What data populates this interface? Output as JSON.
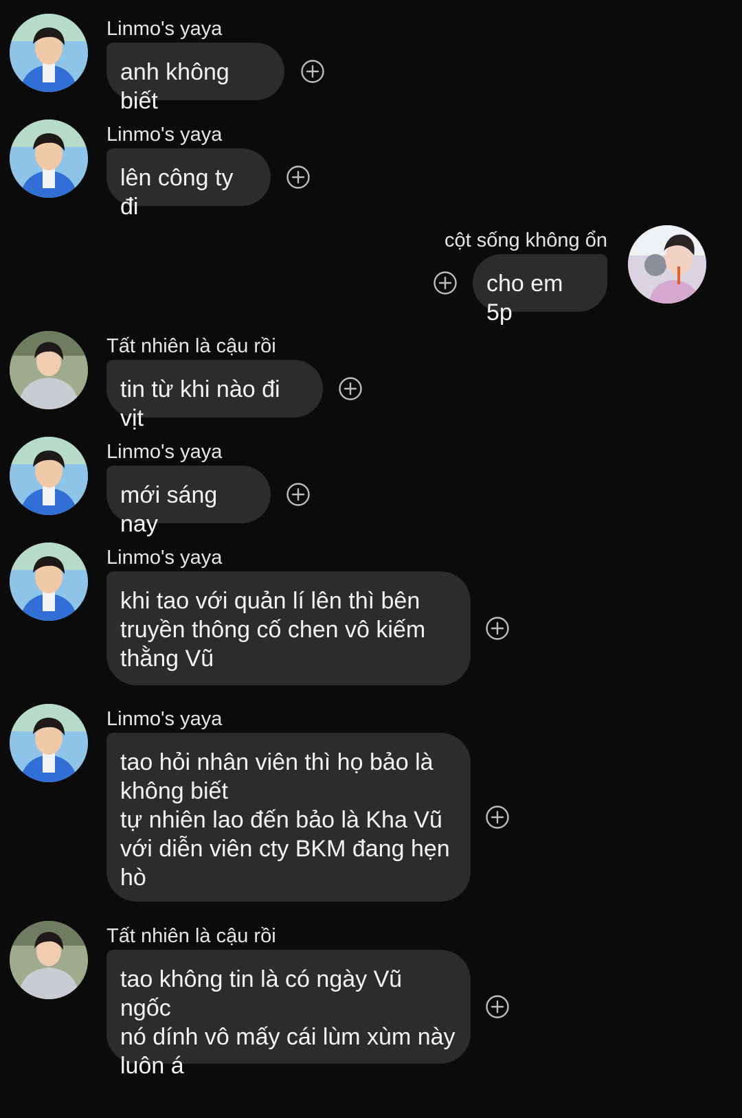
{
  "icons": {
    "react": "add-reaction-icon",
    "avatar": "user-avatar"
  },
  "colors": {
    "background": "#0b0b0b",
    "bubble": "#2c2c2c",
    "text": "#f4f4f4",
    "icon": "#bdbdbd"
  },
  "messages": [
    {
      "sender": "Linmo's yaya",
      "text": "anh không biết"
    },
    {
      "sender": "Linmo's yaya",
      "text": "lên công ty đi"
    },
    {
      "sender": "cột sống không ổn",
      "text": "cho em 5p"
    },
    {
      "sender": "Tất nhiên là cậu rồi",
      "text": "tin từ khi nào đi vịt"
    },
    {
      "sender": "Linmo's yaya",
      "text": "mới sáng nay"
    },
    {
      "sender": "Linmo's yaya",
      "text": "khi tao với quản lí lên thì bên\ntruyền thông cố chen vô kiếm\nthằng Vũ"
    },
    {
      "sender": "Linmo's yaya",
      "text": "tao hỏi nhân viên thì họ bảo là\nkhông biết\ntự nhiên lao đến bảo là Kha Vũ\nvới diễn viên cty BKM đang hẹn\nhò"
    },
    {
      "sender": "Tất nhiên là cậu rồi",
      "text": "tao không tin là có ngày Vũ ngốc\nnó dính vô mấy cái lùm xùm này\nluôn á"
    }
  ]
}
